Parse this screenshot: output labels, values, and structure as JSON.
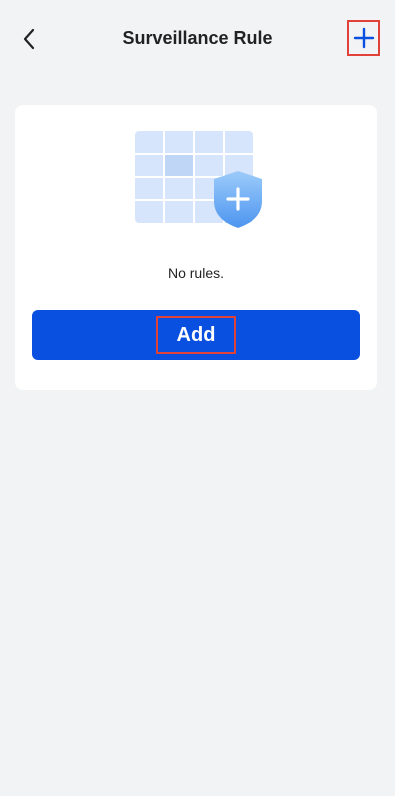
{
  "header": {
    "title": "Surveillance Rule",
    "back_icon": "chevron-left-icon",
    "add_icon": "plus-icon"
  },
  "empty_state": {
    "illustration": "calendar-shield-plus-illustration",
    "message": "No rules.",
    "button_label": "Add"
  },
  "colors": {
    "background": "#f2f3f5",
    "card": "#ffffff",
    "accent": "#0a50e0",
    "highlight_border": "#e0423a"
  }
}
